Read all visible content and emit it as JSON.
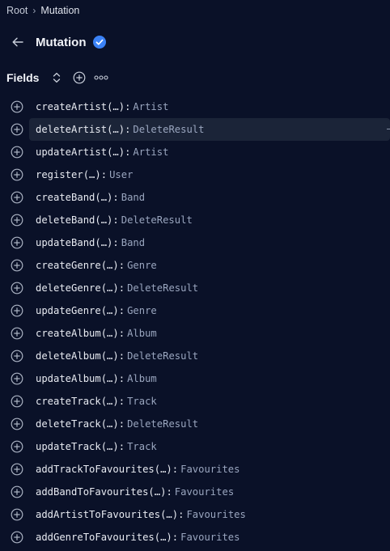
{
  "breadcrumb": {
    "root": "Root",
    "separator": "›",
    "current": "Mutation"
  },
  "header": {
    "back_icon": "arrow-left-icon",
    "title": "Mutation",
    "verified_icon": "check-circle-icon",
    "verified_color": "#3b82f6"
  },
  "fields_section": {
    "title": "Fields",
    "sort_icon": "sort-chevrons-icon",
    "add_icon": "plus-circle-icon",
    "more_icon": "more-dots-icon"
  },
  "fields": [
    {
      "name": "createArtist",
      "args": "(…)",
      "type": "Artist"
    },
    {
      "name": "deleteArtist",
      "args": "(…)",
      "type": "DeleteResult",
      "highlighted": true
    },
    {
      "name": "updateArtist",
      "args": "(…)",
      "type": "Artist"
    },
    {
      "name": "register",
      "args": "(…)",
      "type": "User"
    },
    {
      "name": "createBand",
      "args": "(…)",
      "type": "Band"
    },
    {
      "name": "deleteBand",
      "args": "(…)",
      "type": "DeleteResult"
    },
    {
      "name": "updateBand",
      "args": "(…)",
      "type": "Band"
    },
    {
      "name": "createGenre",
      "args": "(…)",
      "type": "Genre"
    },
    {
      "name": "deleteGenre",
      "args": "(…)",
      "type": "DeleteResult"
    },
    {
      "name": "updateGenre",
      "args": "(…)",
      "type": "Genre"
    },
    {
      "name": "createAlbum",
      "args": "(…)",
      "type": "Album"
    },
    {
      "name": "deleteAlbum",
      "args": "(…)",
      "type": "DeleteResult"
    },
    {
      "name": "updateAlbum",
      "args": "(…)",
      "type": "Album"
    },
    {
      "name": "createTrack",
      "args": "(…)",
      "type": "Track"
    },
    {
      "name": "deleteTrack",
      "args": "(…)",
      "type": "DeleteResult"
    },
    {
      "name": "updateTrack",
      "args": "(…)",
      "type": "Track"
    },
    {
      "name": "addTrackToFavourites",
      "args": "(…)",
      "type": "Favourites"
    },
    {
      "name": "addBandToFavourites",
      "args": "(…)",
      "type": "Favourites"
    },
    {
      "name": "addArtistToFavourites",
      "args": "(…)",
      "type": "Favourites"
    },
    {
      "name": "addGenreToFavourites",
      "args": "(…)",
      "type": "Favourites"
    }
  ],
  "field_separator": ":",
  "row_add_icon": "plus-circle-icon"
}
